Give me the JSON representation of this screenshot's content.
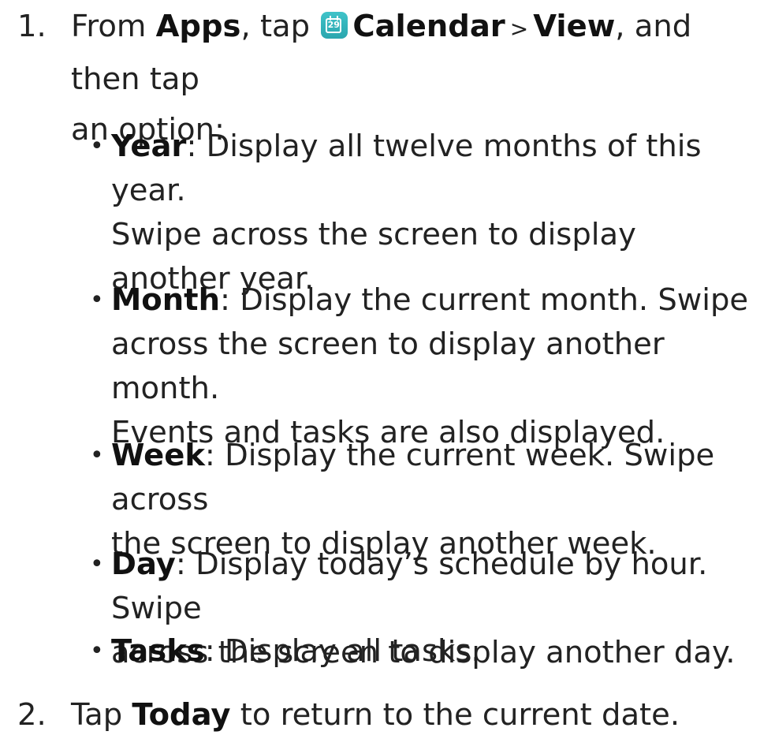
{
  "step1": {
    "number": "1.",
    "prefix": "From ",
    "apps": "Apps",
    "tap": ", tap ",
    "calendar_icon": "calendar-app-icon",
    "calendar_icon_day": "29",
    "calendar": "Calendar",
    "separator": ">",
    "view": "View",
    "suffix_line1": ", and then tap",
    "suffix_line2": "an option:"
  },
  "options": [
    {
      "name": "Year",
      "line1": ": Display all twelve months of this year.",
      "line2": "Swipe across the screen to display",
      "line3": "another year."
    },
    {
      "name": "Month",
      "line1": ": Display the current month. Swipe",
      "line2": "across the screen to display another month.",
      "line3": "Events and tasks are also displayed."
    },
    {
      "name": "Week",
      "line1": ": Display the current week. Swipe across",
      "line2": "the screen to display another week."
    },
    {
      "name": "Day",
      "line1": ": Display today’s schedule by hour. Swipe",
      "line2": "across the screen to display another day."
    },
    {
      "name": "Tasks",
      "line1": ": Display all tasks."
    }
  ],
  "step2": {
    "number": "2.",
    "prefix": "Tap ",
    "today": "Today",
    "suffix": " to return to the current date."
  },
  "bullet_symbol": "•",
  "colors": {
    "text": "#222222",
    "icon_teal": "#2fb3ba"
  }
}
